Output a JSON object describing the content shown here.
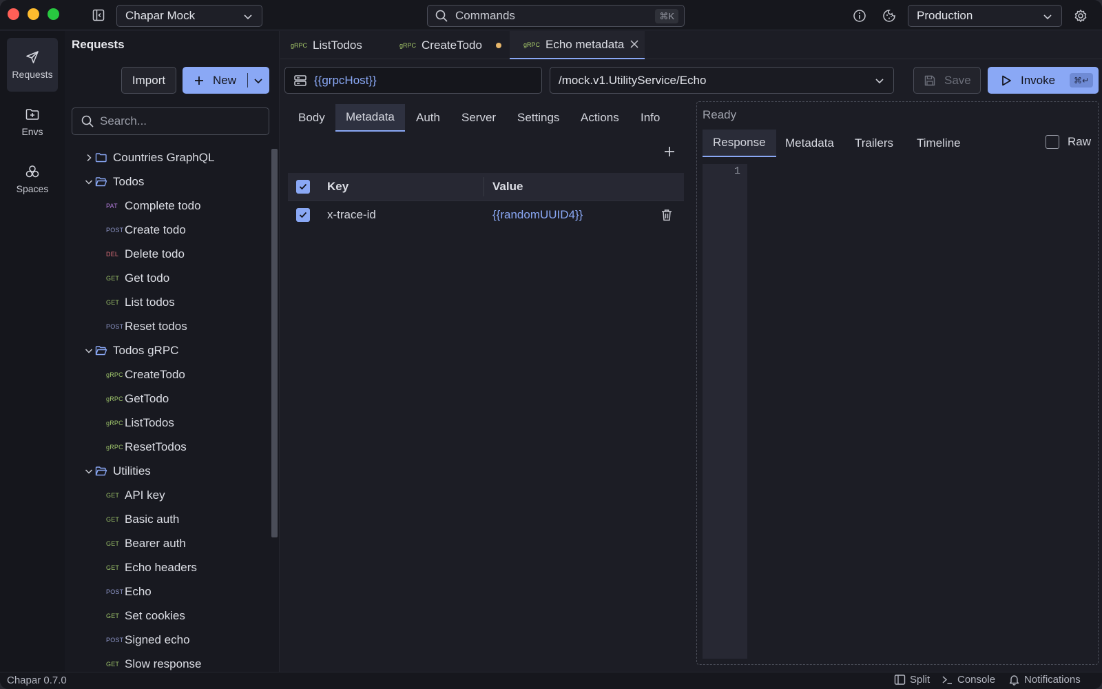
{
  "titlebar": {
    "workspace": "Chapar Mock",
    "commands_label": "Commands",
    "commands_shortcut": "⌘K",
    "environment": "Production"
  },
  "rail": [
    {
      "label": "Requests",
      "icon": "send-icon",
      "active": true
    },
    {
      "label": "Envs",
      "icon": "folder-plus-icon",
      "active": false
    },
    {
      "label": "Spaces",
      "icon": "spaces-icon",
      "active": false
    }
  ],
  "sidebar": {
    "title": "Requests",
    "import_label": "Import",
    "new_label": "New",
    "search_placeholder": "Search..."
  },
  "tree": [
    {
      "kind": "folder",
      "name": "Countries GraphQL",
      "expanded": false
    },
    {
      "kind": "folder",
      "name": "Todos",
      "expanded": true
    },
    {
      "kind": "request",
      "method": "PAT",
      "name": "Complete todo"
    },
    {
      "kind": "request",
      "method": "POST",
      "name": "Create todo"
    },
    {
      "kind": "request",
      "method": "DEL",
      "name": "Delete todo"
    },
    {
      "kind": "request",
      "method": "GET",
      "name": "Get todo"
    },
    {
      "kind": "request",
      "method": "GET",
      "name": "List todos"
    },
    {
      "kind": "request",
      "method": "POST",
      "name": "Reset todos"
    },
    {
      "kind": "folder",
      "name": "Todos gRPC",
      "expanded": true
    },
    {
      "kind": "request",
      "method": "gRPC",
      "name": "CreateTodo"
    },
    {
      "kind": "request",
      "method": "gRPC",
      "name": "GetTodo"
    },
    {
      "kind": "request",
      "method": "gRPC",
      "name": "ListTodos"
    },
    {
      "kind": "request",
      "method": "gRPC",
      "name": "ResetTodos"
    },
    {
      "kind": "folder",
      "name": "Utilities",
      "expanded": true
    },
    {
      "kind": "request",
      "method": "GET",
      "name": "API key"
    },
    {
      "kind": "request",
      "method": "GET",
      "name": "Basic auth"
    },
    {
      "kind": "request",
      "method": "GET",
      "name": "Bearer auth"
    },
    {
      "kind": "request",
      "method": "GET",
      "name": "Echo headers"
    },
    {
      "kind": "request",
      "method": "POST",
      "name": "Echo"
    },
    {
      "kind": "request",
      "method": "GET",
      "name": "Set cookies"
    },
    {
      "kind": "request",
      "method": "POST",
      "name": "Signed echo"
    },
    {
      "kind": "request",
      "method": "GET",
      "name": "Slow response"
    }
  ],
  "method_colors": {
    "PAT": "#b07ad8",
    "POST": "#8e97c9",
    "DEL": "#e0707a",
    "GET": "#9cc26a",
    "gRPC": "#9cc26a"
  },
  "tabs": [
    {
      "method": "gRPC",
      "name": "ListTodos",
      "active": false,
      "dirty": false
    },
    {
      "method": "gRPC",
      "name": "CreateTodo",
      "active": false,
      "dirty": true
    },
    {
      "method": "gRPC",
      "name": "Echo metadata",
      "active": true,
      "dirty": false
    }
  ],
  "request": {
    "host": "{{grpcHost}}",
    "method_path": "/mock.v1.UtilityService/Echo",
    "save_label": "Save",
    "invoke_label": "Invoke",
    "invoke_shortcut": "⌘↵"
  },
  "request_tabs": [
    "Body",
    "Metadata",
    "Auth",
    "Server",
    "Settings",
    "Actions",
    "Info"
  ],
  "active_request_tab": "Metadata",
  "metadata": {
    "headers": {
      "key": "Key",
      "value": "Value"
    },
    "rows": [
      {
        "enabled": true,
        "key": "x-trace-id",
        "value": "{{randomUUID4}}"
      }
    ]
  },
  "response": {
    "status": "Ready",
    "tabs": [
      "Response",
      "Metadata",
      "Trailers",
      "Timeline"
    ],
    "active_tab": "Response",
    "raw_label": "Raw",
    "raw_checked": false,
    "line_number": "1"
  },
  "statusbar": {
    "version": "Chapar 0.7.0",
    "split": "Split",
    "console": "Console",
    "notifications": "Notifications"
  },
  "colors": {
    "accent": "#8aa8f5",
    "dirty_dot": "#e7b66a"
  }
}
